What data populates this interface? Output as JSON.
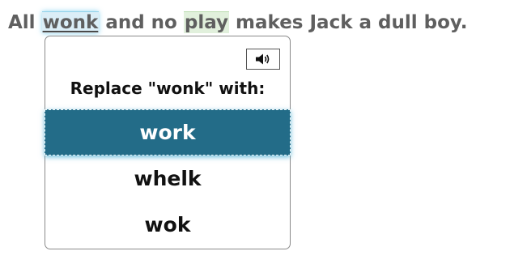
{
  "sentence": {
    "before": "All ",
    "misspelled_word": "wonk",
    "middle": " and no ",
    "flagged_word": "play",
    "after": " makes Jack a dull boy."
  },
  "popup": {
    "speak_icon": "speaker-icon",
    "prompt_prefix": "Replace \"",
    "prompt_word": "wonk",
    "prompt_suffix": "\" with:",
    "suggestions": [
      "work",
      "whelk",
      "wok"
    ],
    "selected_index": 0
  },
  "colors": {
    "misspelled_highlight": "#dbeef7",
    "grammar_highlight": "#e1f0dc",
    "selected_bg": "#236c88",
    "text_gray": "#5f5f5f"
  }
}
